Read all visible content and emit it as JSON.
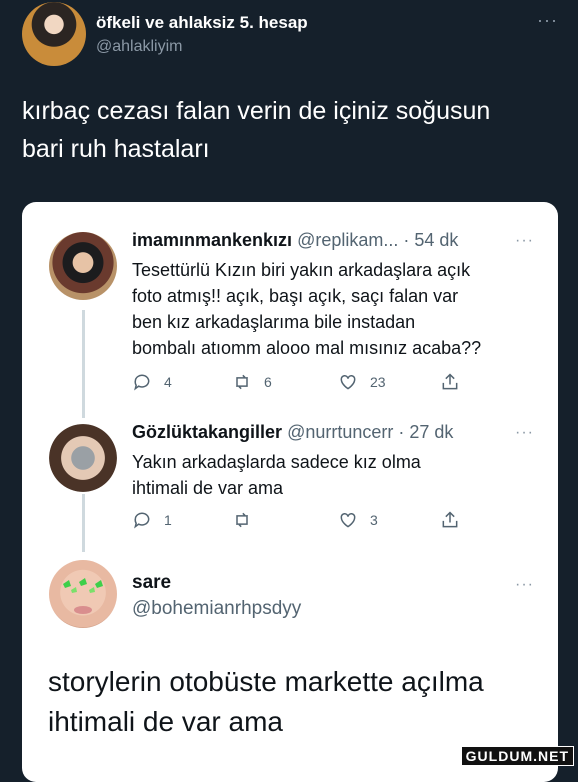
{
  "outer_tweet": {
    "name": "öfkeli ve ahlaksiz 5. hesap",
    "handle": "@ahlakliyim",
    "more": "···",
    "text": "kırbaç cezası falan verin de içiniz soğusun\nbari ruh hastaları"
  },
  "quoted_thread": [
    {
      "name": "imamınmankenkızı",
      "handle": "@replikam... · 54 dk",
      "more": "···",
      "text": "Tesettürlü Kızın biri yakın arkadaşlara açık\nfoto atmış!! açık, başı açık, saçı falan var\nben kız arkadaşlarıma bile instadan\nbombalı atıomm alooo mal mısınız acaba??",
      "replies": "4",
      "retweets": "6",
      "likes": "23"
    },
    {
      "name": "Gözlüktakangiller",
      "handle": "@nurrtuncerr · 27 dk",
      "more": "···",
      "text": "Yakın arkadaşlarda sadece kız olma\nihtimali de var ama",
      "replies": "1",
      "retweets": "",
      "likes": "3"
    }
  ],
  "main_reply": {
    "name": "sare",
    "handle": "@bohemianrhpsdyy",
    "more": "···",
    "text": "storylerin otobüste markette açılma\nihtimali de var ama"
  },
  "watermark": "GULDUM.NET",
  "colors": {
    "background": "#15202b",
    "card": "#ffffff",
    "secondary_text": "#536471",
    "thread_line": "#cfd9de"
  },
  "icons": [
    "reply-icon",
    "retweet-icon",
    "like-icon",
    "share-icon",
    "more-icon"
  ]
}
